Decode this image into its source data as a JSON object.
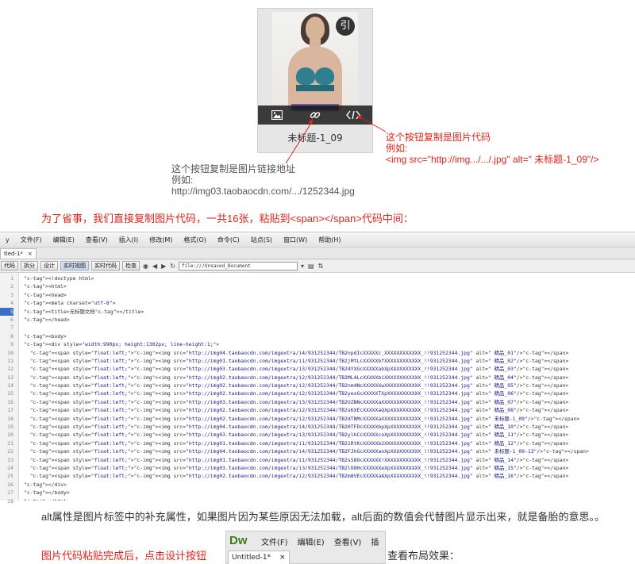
{
  "card": {
    "badge": "引",
    "name": "未标题-1_09",
    "buttons": [
      {
        "icon": "image-icon"
      },
      {
        "icon": "link-icon"
      },
      {
        "icon": "code-icon"
      }
    ]
  },
  "annotations": {
    "link_note": [
      "这个按钮复制是图片链接地址",
      "例如:",
      "http://img03.taobaocdn.com/.../1252344.jpg"
    ],
    "code_note": [
      "这个按钮复制是图片代码",
      "例如:",
      "<img src=\"http://img.../.../.jpg\" alt=\" 未标题-1_09\"/>"
    ]
  },
  "instruction": "为了省事，我们直接复制图片代码，一共16张，粘贴到<span></span>代码中间：",
  "dw": {
    "menu": [
      "y",
      "文件(F)",
      "编辑(E)",
      "查看(V)",
      "插入(I)",
      "修改(M)",
      "格式(O)",
      "命令(C)",
      "站点(S)",
      "窗口(W)",
      "帮助(H)"
    ],
    "tab_label": "tled-1*",
    "tab_close": "×",
    "toolbar": {
      "code": "代码",
      "split": "拆分",
      "design": "设计",
      "live_view": "实时视图",
      "live_code": "实时代码",
      "inspect": "检查",
      "address": "file:///Unsaved_Document"
    },
    "current_line": 5,
    "lines": [
      "<!doctype html>",
      "<html>",
      "<head>",
      "<meta charset=\"utf-8\">",
      "<title>无标题文档</title>",
      "</head>",
      "",
      "<body>",
      "<div style=\"width:990px; height:1302px; line-height:1;\">",
      "  <span style=\"float:left;\"><img src=\"http://img04.taobaocdn.com/imgextra/i4/931252344/TB2npdIcXXXXXc_XXXXXXXXXXXX_!!931252344.jpg\" alt=\" 精品_01\"/></span>",
      "  <span style=\"float:left;\"><img src=\"http://img01.taobaocdn.com/imgextra/i1/931252344/TB2jMtLcXXXXXbfXXXXXXXXXXXX_!!931252344.jpg\" alt=\" 精品_02\"/></span>",
      "  <span style=\"float:left;\"><img src=\"http://img03.taobaocdn.com/imgextra/i3/931252344/TB24YXGcXXXXXabXpXXXXXXXXXX_!!931252344.jpg\" alt=\" 精品_03\"/></span>",
      "  <span style=\"float:left;\"><img src=\"http://img02.taobaocdn.com/imgextra/i2/931252344/TB2ML4LcXXXXXbiXXXXXXXXXXXX_!!931252344.jpg\" alt=\" 精品_04\"/></span>",
      "  <span style=\"float:left;\"><img src=\"http://img02.taobaocdn.com/imgextra/i2/931252344/TB2nm4NcXXXXXXwXXXXXXXXXXXX_!!931252344.jpg\" alt=\" 精品_05\"/></span>",
      "  <span style=\"float:left;\"><img src=\"http://img02.taobaocdn.com/imgextra/i2/931252344/TB2yexGcXXXXXTXpXXXXXXXXXXX_!!931252344.jpg\" alt=\" 精品_06\"/></span>",
      "  <span style=\"float:left;\"><img src=\"http://img03.taobaocdn.com/imgextra/i3/931252344/TB2UZNNcXXXXXaXXXXXXXXXXXXX_!!931252344.jpg\" alt=\" 精品_07\"/></span>",
      "  <span style=\"float:left;\"><img src=\"http://img02.taobaocdn.com/imgextra/i2/931252344/TB2sKXEcXXXXXaQXpXXXXXXXXXX_!!931252344.jpg\" alt=\" 精品_08\"/></span>",
      "  <span style=\"float:left;\"><img src=\"http://img02.taobaocdn.com/imgextra/i2/931252344/TB2dTNMcXXXXXaXXXXXXXXXXXXX_!!931252344.jpg\" alt=\" 未标题-1_09\"/></span>",
      "  <span style=\"float:left;\"><img src=\"http://img04.taobaocdn.com/imgextra/i4/931252344/TB20TFDcXXXXXbpXpXXXXXXXXXX_!!931252344.jpg\" alt=\" 精品_10\"/></span>",
      "  <span style=\"float:left;\"><img src=\"http://img03.taobaocdn.com/imgextra/i3/931252344/TB2ylhCcXXXXXcoXpXXXXXXXXXX_!!931252344.jpg\" alt=\" 精品_11\"/></span>",
      "  <span style=\"float:left;\"><img src=\"http://img01.taobaocdn.com/imgextra/i1/931252344/TB21RtKcXXXXXb2XXXXXXXXXXXX_!!931252344.jpg\" alt=\" 精品_12\"/></span>",
      "  <span style=\"float:left;\"><img src=\"http://img04.taobaocdn.com/imgextra/i4/931252344/TB2FJhGcXXXXXanXpXXXXXXXXXX_!!931252344.jpg\" alt=\" 未标题-1_09-13\"/></span>",
      "  <span style=\"float:left;\"><img src=\"http://img01.taobaocdn.com/imgextra/i1/931252344/TB2sS8OcXXXXXX!XXXXXXXXXXXX_!!931252344.jpg\" alt=\" 精品_14\"/></span>",
      "  <span style=\"float:left;\"><img src=\"http://img03.taobaocdn.com/imgextra/i3/931252344/TB2lO8HcXXXXXXeXpXXXXXXXXXX_!!931252344.jpg\" alt=\" 精品_15\"/></span>",
      "  <span style=\"float:left;\"><img src=\"http://img02.taobaocdn.com/imgextra/i2/931252344/TB2m8VEcXXXXXaAXpXXXXXXXXXX_!!931252344.jpg\" alt=\" 精品_16\"/></span>",
      "</div>",
      "</body>",
      "</html>"
    ]
  },
  "paragraph": "alt属性是图片标签中的补充属性，如果图片因为某些原因无法加载，alt后面的数值会代替图片显示出来，就是备胎的意思。。",
  "paragraph2": "图片代码粘贴完成后，点击设计按钮",
  "paragraph3": "查看布局效果：",
  "mini_dw": {
    "logo": "Dw",
    "menu": [
      "文件(F)",
      "编辑(E)",
      "查看(V)",
      "插"
    ],
    "tab": "Untitled-1*",
    "tab_close": "×"
  },
  "colors": {
    "red": "#e0241a",
    "tag_blue": "#2222aa",
    "img_purple": "#9b1f8f",
    "dw_green": "#3d7a1c"
  }
}
